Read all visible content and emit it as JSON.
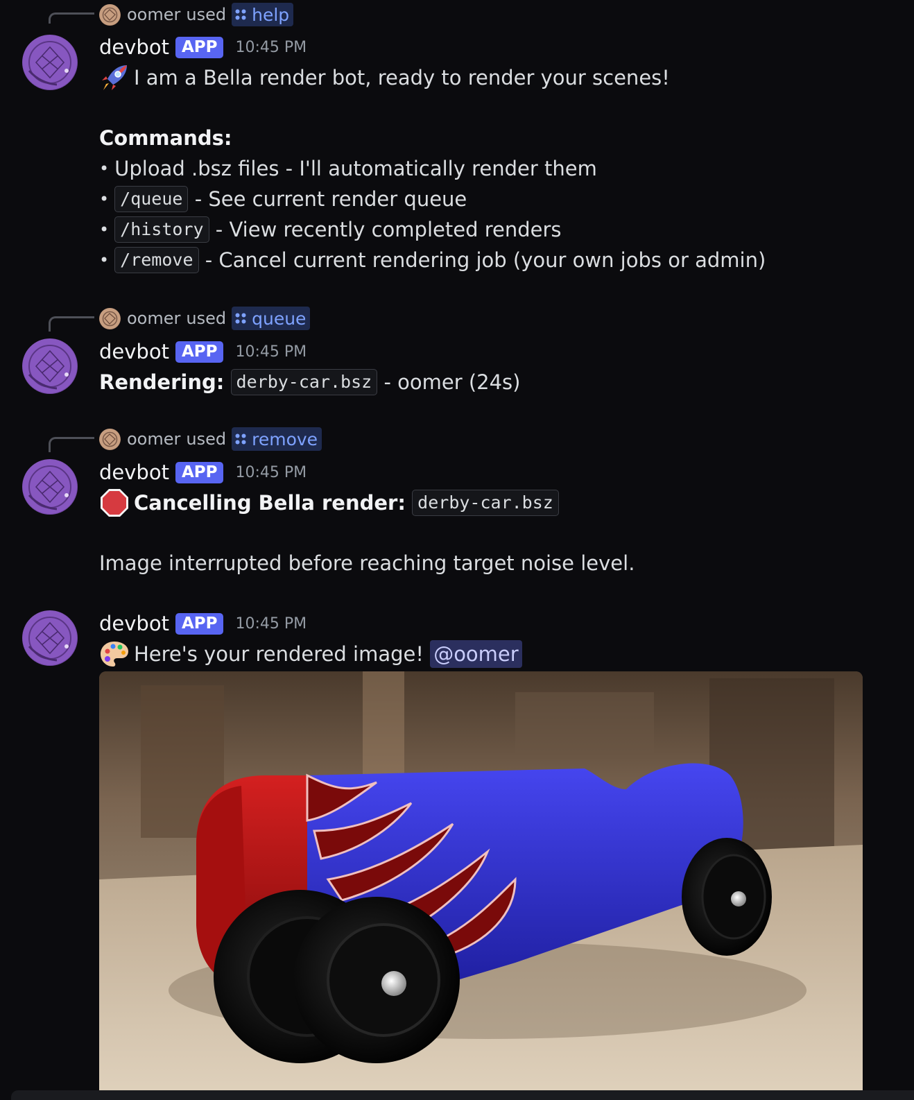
{
  "messages": [
    {
      "reply": {
        "user": "oomer",
        "used": "used",
        "command": "help"
      },
      "author": "devbot",
      "badge": "APP",
      "time": "10:45 PM",
      "intro_emoji": "rocket-emoji",
      "intro": "I am a Bella render bot, ready to render your scenes!",
      "commands_heading": "Commands:",
      "items": [
        {
          "code": "",
          "text": "Upload .bsz files - I'll automatically render them"
        },
        {
          "code": "/queue",
          "text": "- See current render queue"
        },
        {
          "code": "/history",
          "text": "- View recently completed renders"
        },
        {
          "code": "/remove",
          "text": "- Cancel current rendering job (your own jobs or admin)"
        }
      ]
    },
    {
      "reply": {
        "user": "oomer",
        "used": "used",
        "command": "queue"
      },
      "author": "devbot",
      "badge": "APP",
      "time": "10:45 PM",
      "label": "Rendering:",
      "file": "derby-car.bsz",
      "suffix": "- oomer (24s)"
    },
    {
      "reply": {
        "user": "oomer",
        "used": "used",
        "command": "remove"
      },
      "author": "devbot",
      "badge": "APP",
      "time": "10:45 PM",
      "emoji": "stop-sign-emoji",
      "label": "Cancelling Bella render:",
      "file": "derby-car.bsz",
      "note": "Image interrupted before reaching target noise level."
    },
    {
      "author": "devbot",
      "badge": "APP",
      "time": "10:45 PM",
      "emoji": "artist-palette-emoji",
      "text": "Here's your rendered image!",
      "mention": "@oomer",
      "image": "rendered-derby-car-image"
    }
  ],
  "colors": {
    "background": "#0b0b0e",
    "app_badge": "#5865f2",
    "command_chip": "#7ea2ff",
    "mention": "#c9cdfb"
  }
}
